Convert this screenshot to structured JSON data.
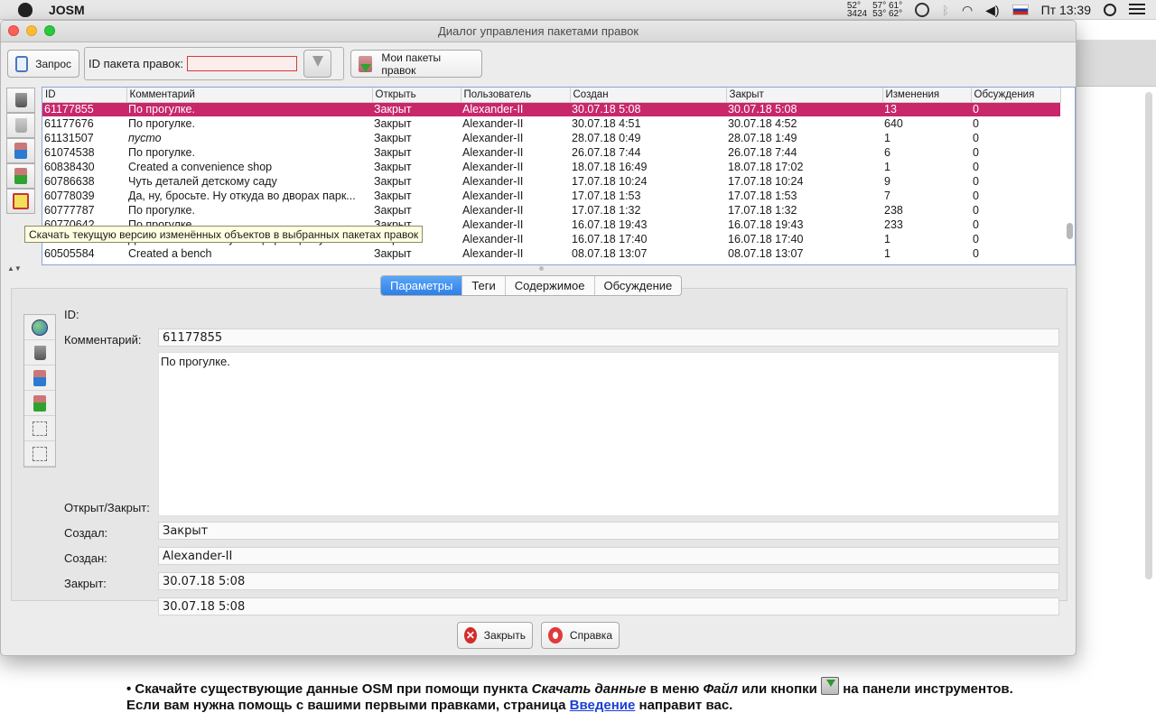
{
  "menubar": {
    "app": "JOSM",
    "temps": [
      "52°",
      "57° 61°",
      "3424",
      "53° 62°"
    ],
    "datetime": "Пт 13:39"
  },
  "dialog": {
    "title": "Диалог управления пакетами правок",
    "toolbar": {
      "query_label": "Запрос",
      "id_label": "ID пакета правок:",
      "id_value": "",
      "my_label": "Мои пакеты правок"
    },
    "table": {
      "columns": [
        "ID",
        "Комментарий",
        "Открыть",
        "Пользователь",
        "Создан",
        "Закрыт",
        "Изменения",
        "Обсуждения"
      ],
      "rows": [
        {
          "id": "61177855",
          "comment": "По прогулке.",
          "open": "Закрыт",
          "user": "Alexander-II",
          "created": "30.07.18 5:08",
          "closed": "30.07.18 5:08",
          "changes": "13",
          "discussions": "0",
          "selected": true
        },
        {
          "id": "61177676",
          "comment": "По прогулке.",
          "open": "Закрыт",
          "user": "Alexander-II",
          "created": "30.07.18 4:51",
          "closed": "30.07.18 4:52",
          "changes": "640",
          "discussions": "0"
        },
        {
          "id": "61131507",
          "comment": "пусто",
          "open": "Закрыт",
          "user": "Alexander-II",
          "created": "28.07.18 0:49",
          "closed": "28.07.18 1:49",
          "changes": "1",
          "discussions": "0",
          "italic": true
        },
        {
          "id": "61074538",
          "comment": "По прогулке.",
          "open": "Закрыт",
          "user": "Alexander-II",
          "created": "26.07.18 7:44",
          "closed": "26.07.18 7:44",
          "changes": "6",
          "discussions": "0"
        },
        {
          "id": "60838430",
          "comment": "Created a convenience shop",
          "open": "Закрыт",
          "user": "Alexander-II",
          "created": "18.07.18 16:49",
          "closed": "18.07.18 17:02",
          "changes": "1",
          "discussions": "0"
        },
        {
          "id": "60786638",
          "comment": "Чуть деталей детскому саду",
          "open": "Закрыт",
          "user": "Alexander-II",
          "created": "17.07.18 10:24",
          "closed": "17.07.18 10:24",
          "changes": "9",
          "discussions": "0"
        },
        {
          "id": "60778039",
          "comment": "Да, ну, бросьте. Ну откуда во дворах парк...",
          "open": "Закрыт",
          "user": "Alexander-II",
          "created": "17.07.18 1:53",
          "closed": "17.07.18 1:53",
          "changes": "7",
          "discussions": "0"
        },
        {
          "id": "60777787",
          "comment": "По прогулке.",
          "open": "Закрыт",
          "user": "Alexander-II",
          "created": "17.07.18 1:32",
          "closed": "17.07.18 1:32",
          "changes": "238",
          "discussions": "0"
        },
        {
          "id": "60770642",
          "comment": "По прогулке.",
          "open": "Закрыт",
          "user": "Alexander-II",
          "created": "16.07.18 19:43",
          "closed": "16.07.18 19:43",
          "changes": "233",
          "discussions": "0"
        },
        {
          "id": "60767597",
          "comment": "Дополнил контактную информацию у кат...",
          "open": "Закрыт",
          "user": "Alexander-II",
          "created": "16.07.18 17:40",
          "closed": "16.07.18 17:40",
          "changes": "1",
          "discussions": "0"
        },
        {
          "id": "60505584",
          "comment": "Created a bench",
          "open": "Закрыт",
          "user": "Alexander-II",
          "created": "08.07.18 13:07",
          "closed": "08.07.18 13:07",
          "changes": "1",
          "discussions": "0"
        }
      ]
    },
    "tooltip": "Скачать текущую версию изменённых объектов в выбранных пакетах правок",
    "tabs": [
      "Параметры",
      "Теги",
      "Содержимое",
      "Обсуждение"
    ],
    "details": {
      "id_label": "ID:",
      "id_value": "61177855",
      "comment_label": "Комментарий:",
      "comment_value": "По прогулке.",
      "state_label": "Открыт/Закрыт:",
      "state_value": "Закрыт",
      "author_label": "Создал:",
      "author_value": "Alexander-II",
      "created_label": "Создан:",
      "created_value": "30.07.18 5:08",
      "closed_label": "Закрыт:",
      "closed_value": "30.07.18 5:08"
    },
    "buttons": {
      "close": "Закрыть",
      "help": "Справка"
    }
  },
  "background": {
    "line1_a": "Скачайте существующие данные OSM при помощи пункта ",
    "line1_italic": "Скачать данные",
    "line1_b": " в меню ",
    "line1_italic2": "Файл",
    "line1_c": " или кнопки ",
    "line1_d": " на панели инструментов. Если вам нужна помощь с вашими первыми правками, страница ",
    "link": "Введение",
    "line1_e": " направит вас."
  }
}
